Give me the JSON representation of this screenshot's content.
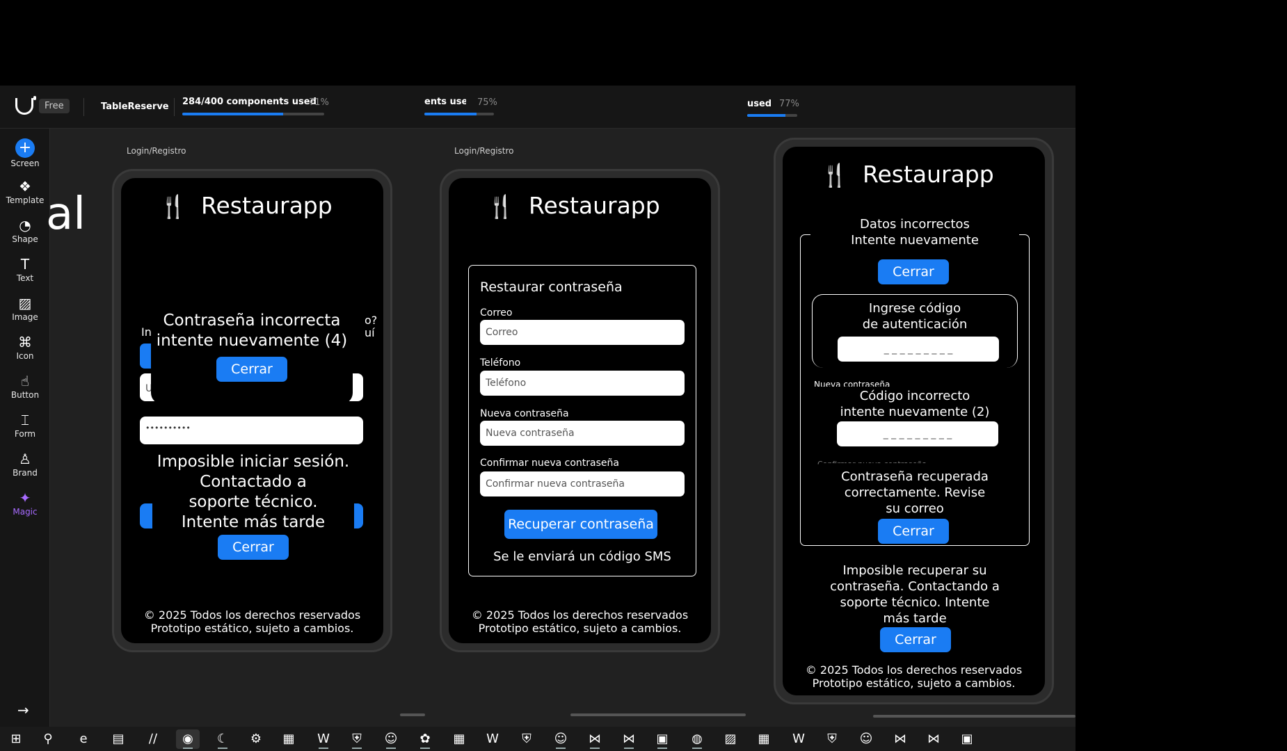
{
  "app": {
    "plan_badge": "Free",
    "project_name": "TableReserve"
  },
  "usage": [
    {
      "label": "284/400 components used",
      "pct": "71%",
      "fraction": 0.71
    },
    {
      "label": "ents used",
      "pct": "75%",
      "fraction": 0.75
    },
    {
      "label": "used",
      "pct": "77%",
      "fraction": 0.77
    }
  ],
  "sidebar": {
    "items": [
      {
        "label": "Screen",
        "icon": "+"
      },
      {
        "label": "Template",
        "icon": "❖"
      },
      {
        "label": "Shape",
        "icon": "◔"
      },
      {
        "label": "Text",
        "icon": "T"
      },
      {
        "label": "Image",
        "icon": "▨"
      },
      {
        "label": "Icon",
        "icon": "⌘"
      },
      {
        "label": "Button",
        "icon": "☝"
      },
      {
        "label": "Form",
        "icon": "⌶"
      },
      {
        "label": "Brand",
        "icon": "♙"
      },
      {
        "label": "Magic",
        "icon": "✦"
      }
    ],
    "collapse_icon": "→"
  },
  "canvas": {
    "partial_text": "al"
  },
  "frames": [
    {
      "label": "Login/Registro"
    },
    {
      "label": "Login/Registro"
    }
  ],
  "brand": {
    "title": "Restaurapp",
    "icon": "🍴"
  },
  "footer": {
    "line1": "© 2025 Todos los derechos reservados",
    "line2": "Prototipo estático, sujeto a cambios."
  },
  "screen1": {
    "frag1": "o?",
    "frag2": "uí",
    "frag3": "In",
    "frag4": "U",
    "password_mask": "••••••••••",
    "alert1": "Contraseña incorrecta\nintente nuevamente (4)",
    "alert1_btn": "Cerrar",
    "alert2": "Imposible iniciar sesión.\nContactado a\nsoporte técnico.\nIntente más tarde",
    "alert2_btn": "Cerrar"
  },
  "screen2": {
    "heading": "Restaurar contraseña",
    "fields": [
      {
        "label": "Correo",
        "placeholder": "Correo"
      },
      {
        "label": "Teléfono",
        "placeholder": "Teléfono"
      },
      {
        "label": "Nueva contraseña",
        "placeholder": "Nueva contraseña"
      },
      {
        "label": "Confirmar nueva contraseña",
        "placeholder": "Confirmar nueva contraseña"
      }
    ],
    "submit": "Recuperar contraseña",
    "note": "Se le enviará un código SMS"
  },
  "screen3": {
    "alert1": "Datos incorrectos\nIntente nuevamente",
    "alert1_btn": "Cerrar",
    "code_prompt": "Ingrese código\nde autenticación",
    "code_mask": "_ _ _ _ _ _ _ _ _",
    "frag_label": "Nueva contraseña",
    "code_error": "Código incorrecto\nintente nuevamente (2)",
    "code_mask2": "_ _ _ _ _ _ _ _ _",
    "frag_label2": "Confirmar nueva contraseña",
    "success": "Contraseña recuperada\ncorrectamente. Revise\nsu correo",
    "success_btn": "Cerrar",
    "fail": "Imposible recuperar su\ncontraseña. Contactando a\nsoporte técnico. Intente\nmás tarde",
    "fail_btn": "Cerrar"
  },
  "taskbar": [
    "⊞",
    "⚲",
    "e",
    "▤",
    "∕∕",
    "◉",
    "☾",
    "⚙",
    "▦",
    "W",
    "⛨",
    "☺",
    "✿",
    "▦",
    "W",
    "⛨",
    "☺",
    "⋈",
    "⋈",
    "▣",
    "◍",
    "▨",
    "▦",
    "W",
    "⛨",
    "☺",
    "⋈",
    "⋈",
    "▣"
  ],
  "colors": {
    "accent": "#1a7cf3",
    "magic": "#a76bff",
    "canvas": "#212121"
  }
}
